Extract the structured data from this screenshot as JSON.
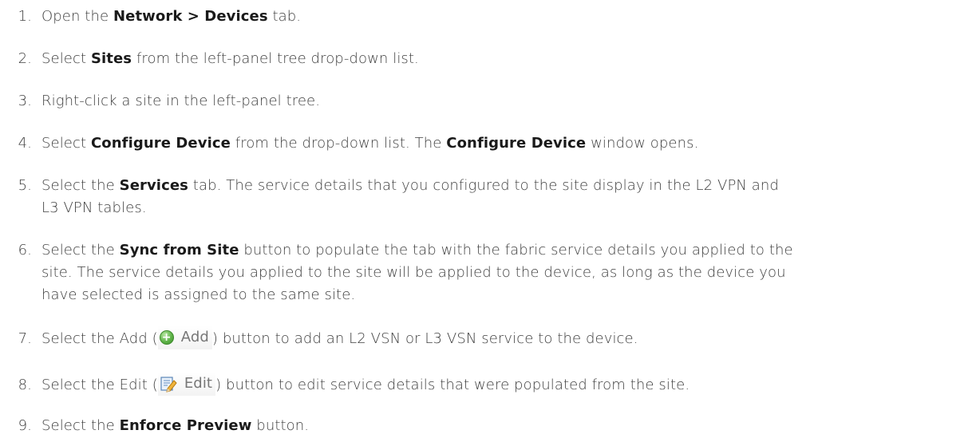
{
  "steps": [
    {
      "num": "1.",
      "pre": "Open the ",
      "bold": "Network > Devices",
      "post": " tab."
    },
    {
      "num": "2.",
      "pre": "Select ",
      "bold": "Sites",
      "post": " from the left-panel tree drop-down list."
    },
    {
      "num": "3.",
      "text": "Right-click a site in the left-panel tree."
    },
    {
      "num": "4.",
      "pre": "Select ",
      "bold": "Configure Device",
      "mid": " from the drop-down list. The ",
      "bold2": "Configure Device",
      "post": " window opens."
    },
    {
      "num": "5.",
      "pre": "Select the ",
      "bold": "Services",
      "post": " tab. The service details that you configured to the site display in the L2 VPN and",
      "line2": "L3 VPN tables."
    },
    {
      "num": "6.",
      "pre": "Select the ",
      "bold": "Sync from Site",
      "post": " button to populate the tab with the fabric service details you applied to the",
      "line2": "site. The service details you applied to the site will be applied to the device, as long as the device you",
      "line3": "have selected is assigned to the same site."
    },
    {
      "num": "7.",
      "pre": "Select the Add (",
      "btn_label": "Add",
      "btn_icon": "add-icon",
      "post": ") button to add an L2 VSN or L3 VSN service to the device."
    },
    {
      "num": "8.",
      "pre": "Select the Edit (",
      "btn_label": "Edit",
      "btn_icon": "edit-icon",
      "post": ") button to edit service details that were populated from the site."
    },
    {
      "num": "9.",
      "pre": "Select the ",
      "bold": "Enforce Preview",
      "post": " button."
    }
  ]
}
